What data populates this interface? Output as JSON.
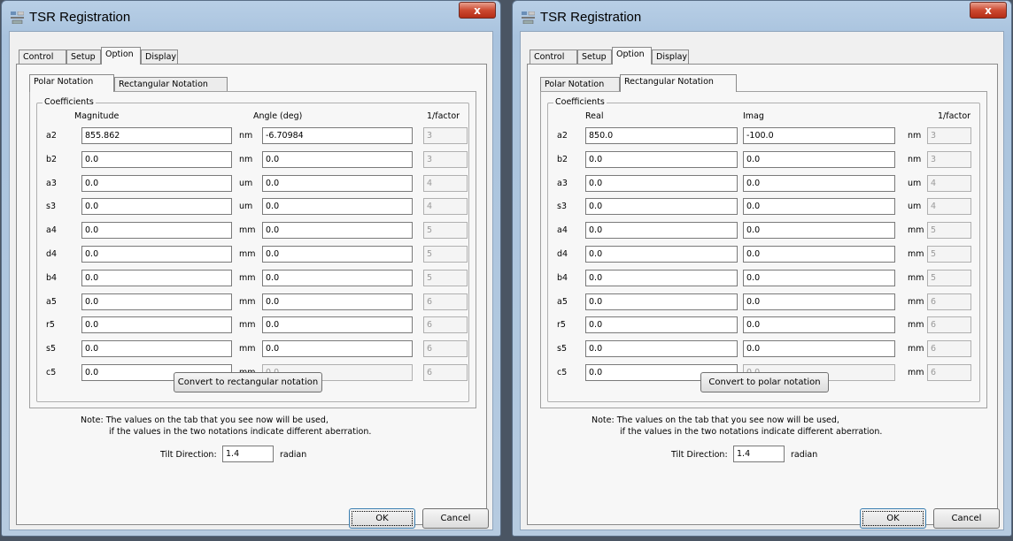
{
  "windows": [
    {
      "title": "TSR Registration",
      "close_glyph": "x",
      "tabs": [
        "Control",
        "Setup",
        "Option",
        "Display"
      ],
      "subtabs": [
        "Polar Notation",
        "Rectangular Notation"
      ],
      "group_label": "Coefficients",
      "col1": "Magnitude",
      "col2": "Angle (deg)",
      "col3": "1/factor",
      "rows": [
        {
          "label": "a2",
          "v1": "855.862",
          "u": "nm",
          "v2": "-6.70984",
          "f": "3",
          "v2dis": false
        },
        {
          "label": "b2",
          "v1": "0.0",
          "u": "nm",
          "v2": "0.0",
          "f": "3",
          "v2dis": false
        },
        {
          "label": "a3",
          "v1": "0.0",
          "u": "um",
          "v2": "0.0",
          "f": "4",
          "v2dis": false
        },
        {
          "label": "s3",
          "v1": "0.0",
          "u": "um",
          "v2": "0.0",
          "f": "4",
          "v2dis": false
        },
        {
          "label": "a4",
          "v1": "0.0",
          "u": "mm",
          "v2": "0.0",
          "f": "5",
          "v2dis": false
        },
        {
          "label": "d4",
          "v1": "0.0",
          "u": "mm",
          "v2": "0.0",
          "f": "5",
          "v2dis": false
        },
        {
          "label": "b4",
          "v1": "0.0",
          "u": "mm",
          "v2": "0.0",
          "f": "5",
          "v2dis": false
        },
        {
          "label": "a5",
          "v1": "0.0",
          "u": "mm",
          "v2": "0.0",
          "f": "6",
          "v2dis": false
        },
        {
          "label": "r5",
          "v1": "0.0",
          "u": "mm",
          "v2": "0.0",
          "f": "6",
          "v2dis": false
        },
        {
          "label": "s5",
          "v1": "0.0",
          "u": "mm",
          "v2": "0.0",
          "f": "6",
          "v2dis": false
        },
        {
          "label": "c5",
          "v1": "0.0",
          "u": "mm",
          "v2": "0.0",
          "f": "6",
          "v2dis": true
        }
      ],
      "convert_label": "Convert to rectangular notation",
      "note_line1": "Note: The values on the tab that you see now will be used,",
      "note_line2": "if the values in the two notations indicate different aberration.",
      "tilt_label": "Tilt Direction:",
      "tilt_value": "1.4",
      "tilt_unit": "radian",
      "ok_label": "OK",
      "cancel_label": "Cancel"
    },
    {
      "title": "TSR Registration",
      "close_glyph": "x",
      "tabs": [
        "Control",
        "Setup",
        "Option",
        "Display"
      ],
      "subtabs": [
        "Polar Notation",
        "Rectangular Notation"
      ],
      "group_label": "Coefficients",
      "col1": "Real",
      "col2": "Imag",
      "col3": "1/factor",
      "rows": [
        {
          "label": "a2",
          "v1": "850.0",
          "u": "nm",
          "v2": "-100.0",
          "f": "3",
          "v2dis": false
        },
        {
          "label": "b2",
          "v1": "0.0",
          "u": "nm",
          "v2": "0.0",
          "f": "3",
          "v2dis": false
        },
        {
          "label": "a3",
          "v1": "0.0",
          "u": "um",
          "v2": "0.0",
          "f": "4",
          "v2dis": false
        },
        {
          "label": "s3",
          "v1": "0.0",
          "u": "um",
          "v2": "0.0",
          "f": "4",
          "v2dis": false
        },
        {
          "label": "a4",
          "v1": "0.0",
          "u": "mm",
          "v2": "0.0",
          "f": "5",
          "v2dis": false
        },
        {
          "label": "d4",
          "v1": "0.0",
          "u": "mm",
          "v2": "0.0",
          "f": "5",
          "v2dis": false
        },
        {
          "label": "b4",
          "v1": "0.0",
          "u": "mm",
          "v2": "0.0",
          "f": "5",
          "v2dis": false
        },
        {
          "label": "a5",
          "v1": "0.0",
          "u": "mm",
          "v2": "0.0",
          "f": "6",
          "v2dis": false
        },
        {
          "label": "r5",
          "v1": "0.0",
          "u": "mm",
          "v2": "0.0",
          "f": "6",
          "v2dis": false
        },
        {
          "label": "s5",
          "v1": "0.0",
          "u": "mm",
          "v2": "0.0",
          "f": "6",
          "v2dis": false
        },
        {
          "label": "c5",
          "v1": "0.0",
          "u": "mm",
          "v2": "0.0",
          "f": "6",
          "v2dis": true
        }
      ],
      "convert_label": "Convert to polar notation",
      "note_line1": "Note: The values on the tab that you see now will be used,",
      "note_line2": "if the values in the two notations indicate different aberration.",
      "tilt_label": "Tilt Direction:",
      "tilt_value": "1.4",
      "tilt_unit": "radian",
      "ok_label": "OK",
      "cancel_label": "Cancel"
    }
  ]
}
